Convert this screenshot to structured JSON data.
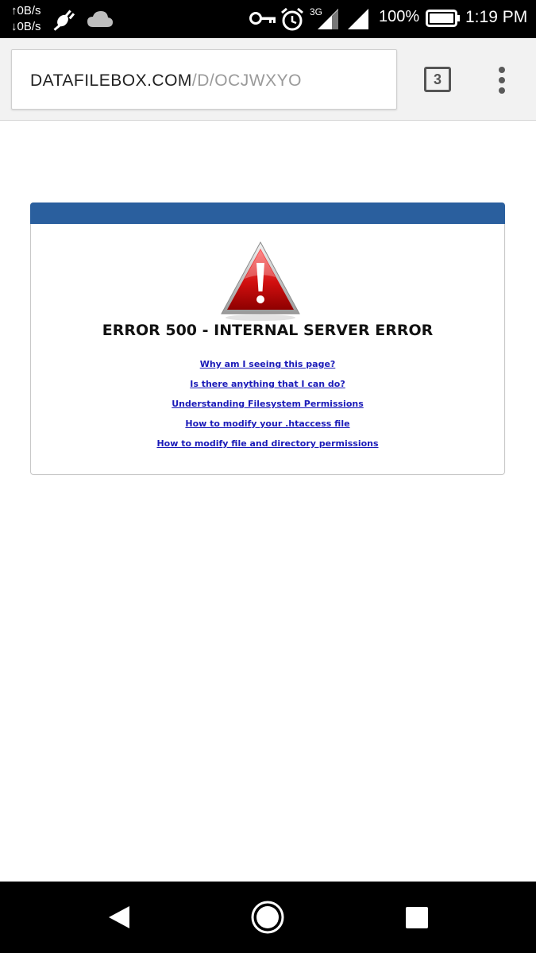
{
  "status_bar": {
    "net_up": "↑0B/s",
    "net_down": "↓0B/s",
    "network_type": "3G",
    "battery": "100%",
    "time": "1:19 PM",
    "icons": [
      "usb-debug-icon",
      "cloud-icon",
      "vpn-key-icon",
      "alarm-icon",
      "signal-icon",
      "wifi-signal-icon",
      "battery-icon"
    ]
  },
  "browser": {
    "url_host": "DATAFILEBOX.COM",
    "url_path": "/D/OCJWXYO",
    "tab_count": "3",
    "menu_icon": "more-vert-icon"
  },
  "error_page": {
    "header_color": "#2a5f9e",
    "icon": "warning-triangle-icon",
    "title": "ERROR 500 - INTERNAL SERVER ERROR",
    "links": [
      "Why am I seeing this page?",
      "Is there anything that I can do?",
      "Understanding Filesystem Permissions",
      "How to modify your .htaccess file",
      "How to modify file and directory permissions"
    ]
  },
  "nav_bar": {
    "back_icon": "back-triangle-icon",
    "home_icon": "home-circle-icon",
    "recents_icon": "recents-square-icon"
  }
}
